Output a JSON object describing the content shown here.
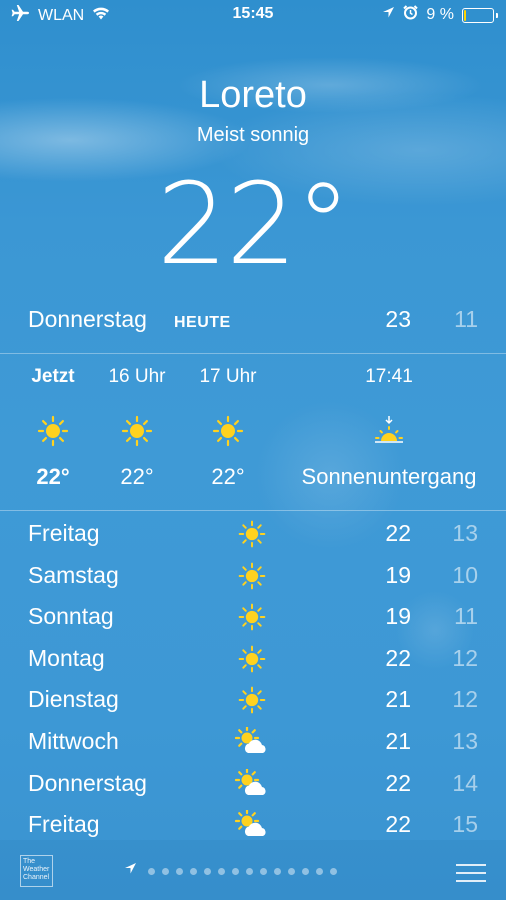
{
  "status_bar": {
    "carrier": "WLAN",
    "time": "15:45",
    "battery": "9 %",
    "battery_level": 0.09
  },
  "header": {
    "city": "Loreto",
    "condition": "Meist sonnig",
    "temperature": "22°"
  },
  "today": {
    "day": "Donnerstag",
    "badge": "HEUTE",
    "high": "23",
    "low": "11"
  },
  "hourly": [
    {
      "label": "Jetzt",
      "icon": "sun-icon",
      "value": "22°"
    },
    {
      "label": "16 Uhr",
      "icon": "sun-icon",
      "value": "22°"
    },
    {
      "label": "17 Uhr",
      "icon": "sun-icon",
      "value": "22°"
    },
    {
      "label": "17:41",
      "icon": "sunset-icon",
      "value": "Sonnenuntergang"
    }
  ],
  "daily": [
    {
      "day": "Freitag",
      "icon": "sun-icon",
      "high": "22",
      "low": "13"
    },
    {
      "day": "Samstag",
      "icon": "sun-icon",
      "high": "19",
      "low": "10"
    },
    {
      "day": "Sonntag",
      "icon": "sun-icon",
      "high": "19",
      "low": "11"
    },
    {
      "day": "Montag",
      "icon": "sun-icon",
      "high": "22",
      "low": "12"
    },
    {
      "day": "Dienstag",
      "icon": "sun-icon",
      "high": "21",
      "low": "12"
    },
    {
      "day": "Mittwoch",
      "icon": "partly-cloudy-icon",
      "high": "21",
      "low": "13"
    },
    {
      "day": "Donnerstag",
      "icon": "partly-cloudy-icon",
      "high": "22",
      "low": "14"
    },
    {
      "day": "Freitag",
      "icon": "partly-cloudy-icon",
      "high": "22",
      "low": "15"
    }
  ],
  "footer": {
    "provider_logo": "The Weather Channel",
    "page_count": 15,
    "active_page": 1
  },
  "colors": {
    "sun": "#ffd21f",
    "background": "#3d98d5",
    "battery_fill": "#ffd400"
  }
}
